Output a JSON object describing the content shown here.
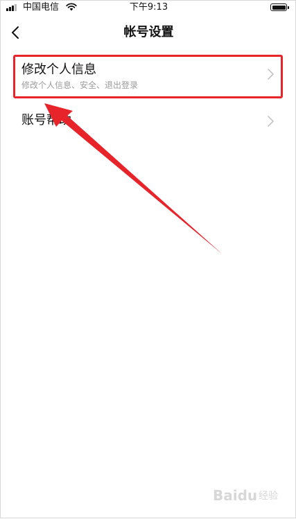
{
  "status_bar": {
    "carrier": "中国电信",
    "time": "下午9:13"
  },
  "nav": {
    "title": "帐号设置"
  },
  "menu": {
    "items": [
      {
        "title": "修改个人信息",
        "subtitle": "修改个人信息、安全、退出登录"
      },
      {
        "title": "账号帮助"
      }
    ]
  },
  "annotation": {
    "color": "#e8242b"
  },
  "watermark": {
    "text": "Baidu",
    "sub": "经验"
  }
}
